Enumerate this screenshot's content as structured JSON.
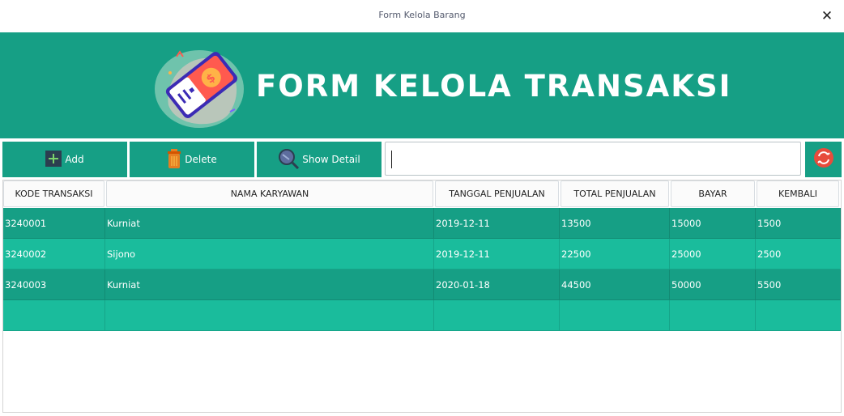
{
  "window": {
    "title": "Form Kelola Barang",
    "close_glyph": "✕"
  },
  "header": {
    "title": "FORM KELOLA TRANSAKSI",
    "logo": "game-ticket-logo-icon"
  },
  "toolbar": {
    "add_label": "Add",
    "delete_label": "Delete",
    "detail_label": "Show Detail",
    "search_value": "",
    "refresh_icon": "refresh-icon"
  },
  "colors": {
    "primary": "#169f85",
    "row_alt": "#1abc9c",
    "refresh": "#e74c3c"
  },
  "table": {
    "columns": [
      "KODE TRANSAKSI",
      "NAMA KARYAWAN",
      "TANGGAL PENJUALAN",
      "TOTAL PENJUALAN",
      "BAYAR",
      "KEMBALI"
    ],
    "rows": [
      [
        "3240001",
        "Kurniat",
        "2019-12-11",
        "13500",
        "15000",
        "1500"
      ],
      [
        "3240002",
        "Sijono",
        "2019-12-11",
        "22500",
        "25000",
        "2500"
      ],
      [
        "3240003",
        "Kurniat",
        "2020-01-18",
        "44500",
        "50000",
        "5500"
      ],
      [
        "",
        "",
        "",
        "",
        "",
        ""
      ]
    ]
  }
}
